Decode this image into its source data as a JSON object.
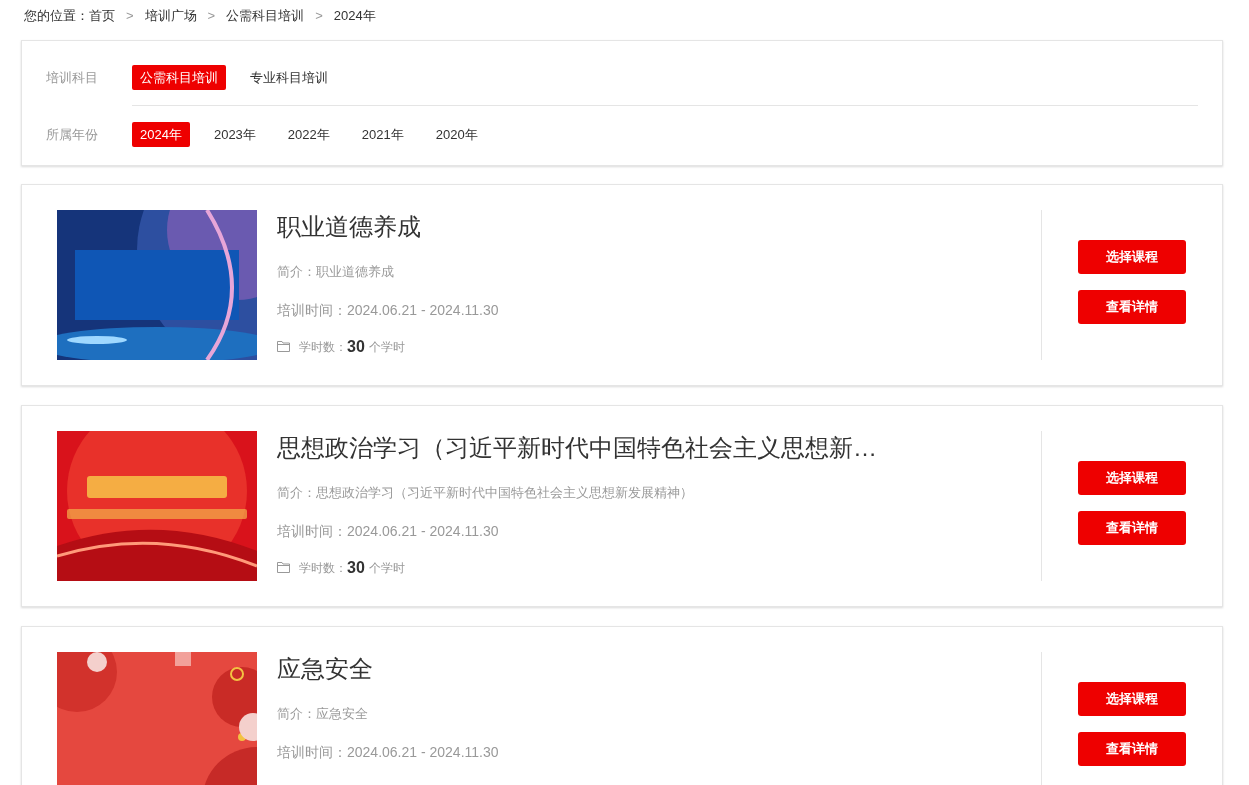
{
  "breadcrumb": {
    "prefix": "您的位置：",
    "items": [
      {
        "kind": "link",
        "text": "首页"
      },
      {
        "kind": "separator",
        "text": ">"
      },
      {
        "kind": "link",
        "text": "培训广场"
      },
      {
        "kind": "separator",
        "text": ">"
      },
      {
        "kind": "link",
        "text": "公需科目培训"
      },
      {
        "kind": "separator",
        "text": ">"
      },
      {
        "kind": "current",
        "text": "2024年"
      }
    ]
  },
  "filters": [
    {
      "label": "培训科目",
      "options": [
        {
          "text": "公需科目培训",
          "selected": true
        },
        {
          "text": "专业科目培训",
          "selected": false
        }
      ]
    },
    {
      "label": "所属年份",
      "options": [
        {
          "text": "2024年",
          "selected": true
        },
        {
          "text": "2023年",
          "selected": false
        },
        {
          "text": "2022年",
          "selected": false
        },
        {
          "text": "2021年",
          "selected": false
        },
        {
          "text": "2020年",
          "selected": false
        }
      ]
    }
  ],
  "courses": [
    {
      "thumbnail": {
        "kind": "picture"
      },
      "title": "职业道德养成",
      "intro": "简介：职业道德养成",
      "period": "培训时间：2024.06.21 - 2024.11.30",
      "hours_label": "学时数：",
      "hours": "30",
      "hours_unit": "个学时",
      "buttons": [
        "选择课程",
        "查看详情"
      ]
    },
    {
      "thumbnail": {
        "kind": "picture"
      },
      "title": "思想政治学习（习近平新时代中国特色社会主义思想新…",
      "intro": "简介：思想政治学习（习近平新时代中国特色社会主义思想新发展精神）",
      "period": "培训时间：2024.06.21 - 2024.11.30",
      "hours_label": "学时数：",
      "hours": "30",
      "hours_unit": "个学时",
      "buttons": [
        "选择课程",
        "查看详情"
      ]
    },
    {
      "thumbnail": {
        "kind": "picture"
      },
      "title": "应急安全",
      "intro": "简介：应急安全",
      "period": "培训时间：2024.06.21 - 2024.11.30",
      "buttons": [
        "选择课程",
        "查看详情"
      ]
    }
  ]
}
